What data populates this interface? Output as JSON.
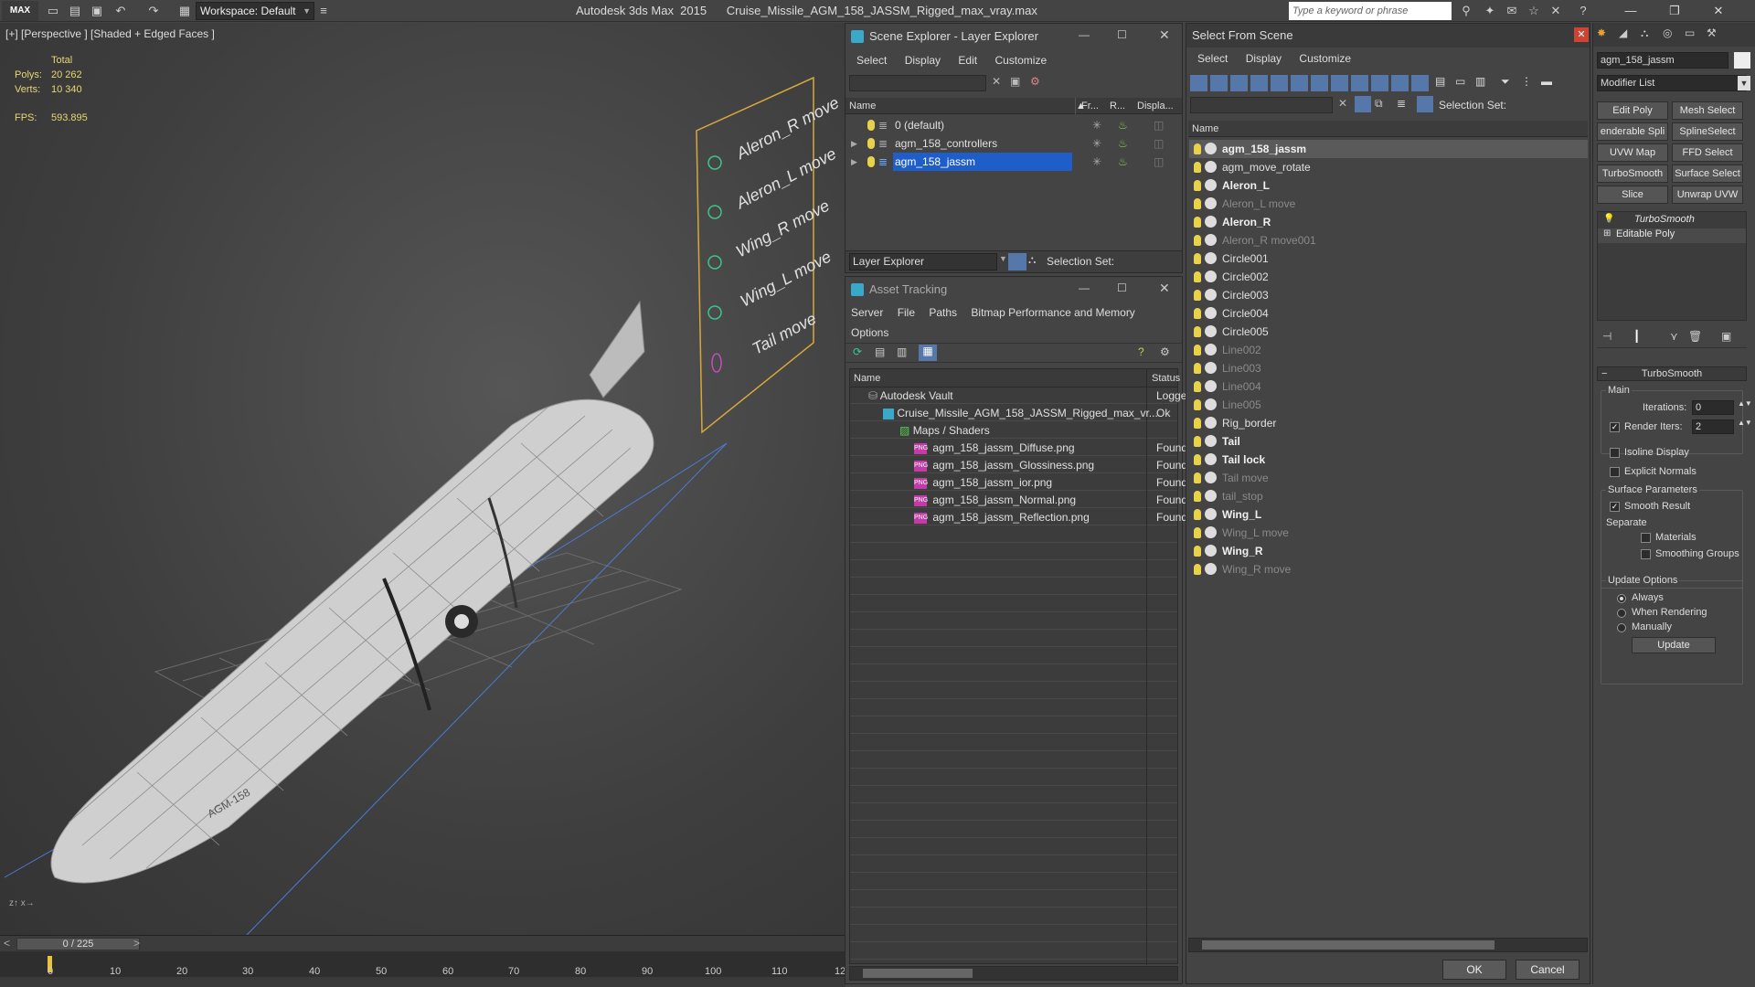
{
  "titlebar": {
    "logo": "MAX",
    "workspace": "Workspace: Default",
    "app_title": "Autodesk 3ds Max  2015      Cruise_Missile_AGM_158_JASSM_Rigged_max_vray.max",
    "search_placeholder": "Type a keyword or phrase"
  },
  "viewport": {
    "label": "[+] [Perspective ] [Shaded + Edged Faces ]",
    "stats": {
      "total_label": "Total",
      "polys_label": "Polys:",
      "polys_value": "20 262",
      "verts_label": "Verts:",
      "verts_value": "10 340",
      "fps_label": "FPS:",
      "fps_value": "593.895"
    },
    "controller_labels": [
      "Aleron_R move",
      "Aleron_L move",
      "Wing_R move",
      "Wing_L move",
      "Tail move"
    ],
    "missile_text": "AGM-158"
  },
  "timeline": {
    "frame": "0 / 225",
    "ticks": [
      "0",
      "10",
      "20",
      "30",
      "40",
      "50",
      "60",
      "70",
      "80",
      "90",
      "100",
      "110",
      "12"
    ]
  },
  "scene_explorer": {
    "title": "Scene Explorer - Layer Explorer",
    "menu": [
      "Select",
      "Display",
      "Edit",
      "Customize"
    ],
    "columns": [
      "Name",
      "Fr...",
      "R...",
      "Displa..."
    ],
    "rows": [
      {
        "name": "0 (default)",
        "selected": false,
        "expandable": false
      },
      {
        "name": "agm_158_controllers",
        "selected": false,
        "expandable": true
      },
      {
        "name": "agm_158_jassm",
        "selected": true,
        "expandable": true
      }
    ],
    "footer_dropdown": "Layer Explorer",
    "selection_set_label": "Selection Set:"
  },
  "asset_tracking": {
    "title": "Asset Tracking",
    "menu": [
      "Server",
      "File",
      "Paths",
      "Bitmap Performance and Memory",
      "Options"
    ],
    "columns": [
      "Name",
      "Status"
    ],
    "rows": [
      {
        "name": "Autodesk Vault",
        "status": "Logge"
      },
      {
        "name": "Cruise_Missile_AGM_158_JASSM_Rigged_max_vr...",
        "status": "Ok"
      },
      {
        "name": "Maps / Shaders",
        "status": ""
      },
      {
        "name": "agm_158_jassm_Diffuse.png",
        "status": "Found"
      },
      {
        "name": "agm_158_jassm_Glossiness.png",
        "status": "Found"
      },
      {
        "name": "agm_158_jassm_ior.png",
        "status": "Found"
      },
      {
        "name": "agm_158_jassm_Normal.png",
        "status": "Found"
      },
      {
        "name": "agm_158_jassm_Reflection.png",
        "status": "Found"
      }
    ]
  },
  "select_from_scene": {
    "title": "Select From Scene",
    "menu": [
      "Select",
      "Display",
      "Customize"
    ],
    "selection_set_label": "Selection Set:",
    "column": "Name",
    "items": [
      {
        "name": "agm_158_jassm",
        "style": "bold-selected"
      },
      {
        "name": "agm_move_rotate",
        "style": "normal"
      },
      {
        "name": "Aleron_L",
        "style": "bold"
      },
      {
        "name": "Aleron_L move",
        "style": "dim"
      },
      {
        "name": "Aleron_R",
        "style": "bold"
      },
      {
        "name": "Aleron_R move001",
        "style": "dim"
      },
      {
        "name": "Circle001",
        "style": "normal"
      },
      {
        "name": "Circle002",
        "style": "normal"
      },
      {
        "name": "Circle003",
        "style": "normal"
      },
      {
        "name": "Circle004",
        "style": "normal"
      },
      {
        "name": "Circle005",
        "style": "normal"
      },
      {
        "name": "Line002",
        "style": "dim"
      },
      {
        "name": "Line003",
        "style": "dim"
      },
      {
        "name": "Line004",
        "style": "dim"
      },
      {
        "name": "Line005",
        "style": "dim"
      },
      {
        "name": "Rig_border",
        "style": "normal"
      },
      {
        "name": "Tail",
        "style": "bold"
      },
      {
        "name": "Tail lock",
        "style": "bold"
      },
      {
        "name": "Tail move",
        "style": "dim"
      },
      {
        "name": "tail_stop",
        "style": "dim"
      },
      {
        "name": "Wing_L",
        "style": "bold"
      },
      {
        "name": "Wing_L move",
        "style": "dim"
      },
      {
        "name": "Wing_R",
        "style": "bold"
      },
      {
        "name": "Wing_R move",
        "style": "dim"
      }
    ],
    "ok_label": "OK",
    "cancel_label": "Cancel"
  },
  "command_panel": {
    "object_name": "agm_158_jassm",
    "modifier_list": "Modifier List",
    "modifier_buttons": [
      "Edit Poly",
      "Mesh Select",
      "enderable Spli",
      "SplineSelect",
      "UVW Map",
      "FFD Select",
      "TurboSmooth",
      "Surface Select",
      "Slice",
      "Unwrap UVW"
    ],
    "stack": [
      "TurboSmooth",
      "Editable Poly"
    ],
    "rollout_title": "TurboSmooth",
    "main_label": "Main",
    "iterations_label": "Iterations:",
    "iterations_value": "0",
    "render_iters_label": "Render Iters:",
    "render_iters_value": "2",
    "isoline_label": "Isoline Display",
    "explicit_normals_label": "Explicit Normals",
    "surface_params_label": "Surface Parameters",
    "smooth_result_label": "Smooth Result",
    "separate_label": "Separate",
    "materials_label": "Materials",
    "smoothing_groups_label": "Smoothing Groups",
    "update_options_label": "Update Options",
    "always_label": "Always",
    "when_rendering_label": "When Rendering",
    "manually_label": "Manually",
    "update_button": "Update"
  },
  "colors": {
    "selection_blue": "#1f5ec8",
    "stats_yellow": "#e8d870",
    "controller_orange": "#d6a83a"
  }
}
